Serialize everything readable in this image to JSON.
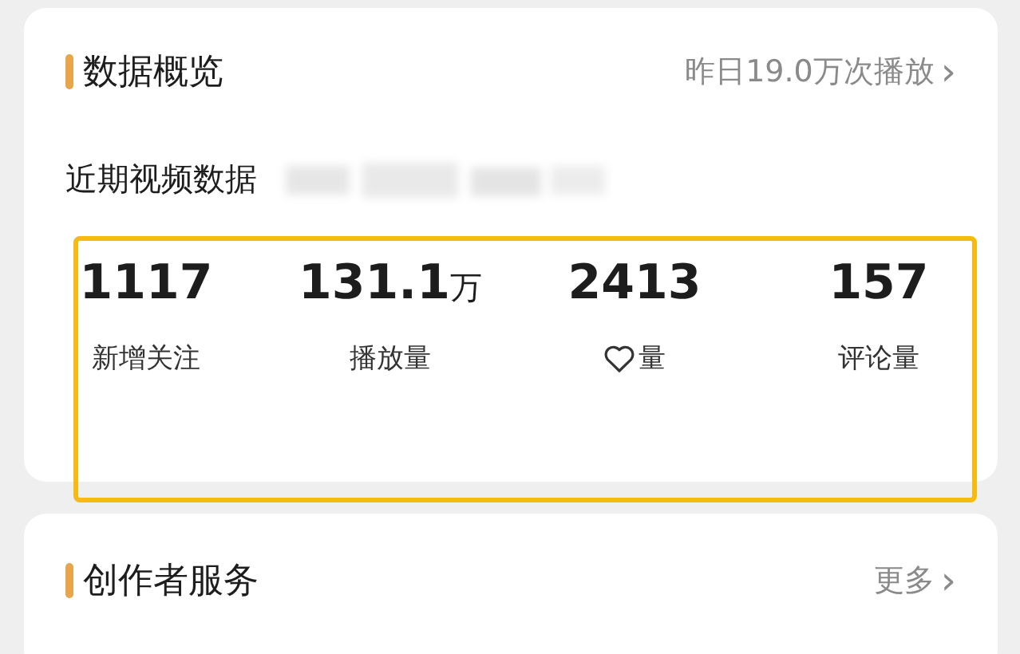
{
  "overview": {
    "title": "数据概览",
    "link": "昨日19.0万次播放",
    "link_chevron": "›",
    "subtitle": "近期视频数据",
    "highlighted": true,
    "stats": [
      {
        "kind": "plain",
        "value": "1117",
        "label": "新增关注"
      },
      {
        "kind": "plain",
        "value": "131.1",
        "unit": "万",
        "label": "播放量"
      },
      {
        "kind": "heart",
        "value": "2413",
        "label": "量"
      },
      {
        "kind": "plain",
        "value": "157",
        "label": "评论量"
      }
    ]
  },
  "creator_services": {
    "title": "创作者服务",
    "link": "更多",
    "link_chevron": "›"
  }
}
